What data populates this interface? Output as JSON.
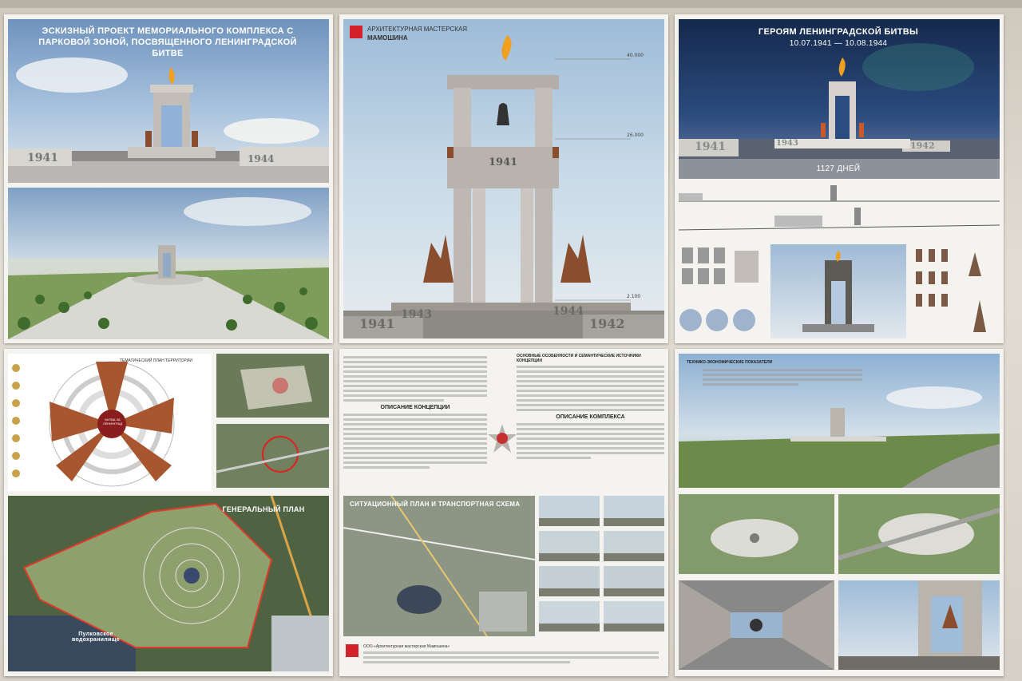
{
  "panel_top_left": {
    "title": "ЭСКИЗНЫЙ ПРОЕКТ МЕМОРИАЛЬНОГО КОМПЛЕКСА С ПАРКОВОЙ ЗОНОЙ, ПОСВЯЩЕННОГО ЛЕНИНГРАДСКОЙ БИТВЕ",
    "year_left": "1941",
    "year_right": "1944"
  },
  "panel_top_center": {
    "studio_line1": "АРХИТЕКТУРНАЯ МАСТЕРСКАЯ",
    "studio_line2": "МАМОШИНА",
    "arch_year": "1941",
    "plinth_years": [
      "1941",
      "1943",
      "1944",
      "1942"
    ],
    "heights": [
      "40.000",
      "26.000",
      "2.100"
    ]
  },
  "panel_top_right": {
    "title": "ГЕРОЯМ ЛЕНИНГРАДСКОЙ БИТВЫ",
    "dates": "10.07.1941 — 10.08.1944",
    "days": "1127 ДНЕЙ",
    "year_a": "1941",
    "year_b": "1943",
    "year_c": "1942"
  },
  "panel_bottom_left": {
    "scheme_label": "ТЕМАТИЧЕСКИЙ ПЛАН ТЕРРИТОРИИ",
    "general_plan": "ГЕНЕРАЛЬНЫЙ ПЛАН",
    "reservoir": "Пулковское водохранилище",
    "center_label": "БИТВА ЗА ЛЕНИНГРАД"
  },
  "panel_bottom_center": {
    "section1": "ОПИСАНИЕ КОНЦЕПЦИИ",
    "section2": "ОСНОВНЫЕ ОСОБЕННОСТИ И СЕМАНТИЧЕСКИЕ ИСТОЧНИКИ КОНЦЕПЦИИ",
    "section3": "ОПИСАНИЕ КОМПЛЕКСА",
    "situation": "СИТУАЦИОННЫЙ ПЛАН И ТРАНСПОРТНАЯ СХЕМА",
    "firm": "ООО «Архитектурная мастерская Мамошина»"
  },
  "panel_bottom_right": {
    "heading": "ТЕХНИКО-ЭКОНОМИЧЕСКИЕ ПОКАЗАТЕЛИ"
  },
  "colors": {
    "sky_blue": "#8fb2d6",
    "night_sky": "#1d3560",
    "stone": "#b8b4ad",
    "flame": "#f0a020",
    "bronze": "#8a4e2e",
    "red_logo": "#d2232a",
    "grass": "#5f8a3a"
  }
}
